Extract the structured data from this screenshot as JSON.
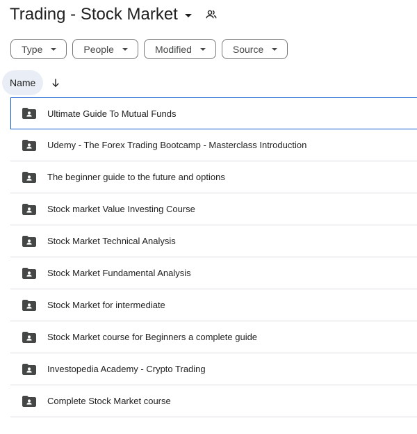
{
  "header": {
    "title": "Trading - Stock Market",
    "title_menu_icon": "caret-down-icon",
    "shared_icon": "people-icon"
  },
  "filters": [
    {
      "label": "Type"
    },
    {
      "label": "People"
    },
    {
      "label": "Modified"
    },
    {
      "label": "Source"
    }
  ],
  "column_header": {
    "name_label": "Name",
    "sort_icon": "arrow-down-icon"
  },
  "folders": [
    {
      "name": "Ultimate Guide To Mutual Funds",
      "selected": true
    },
    {
      "name": "Udemy - The Forex Trading Bootcamp - Masterclass Introduction",
      "selected": false
    },
    {
      "name": "The beginner guide to the future and options",
      "selected": false
    },
    {
      "name": "Stock market Value Investing Course",
      "selected": false
    },
    {
      "name": "Stock Market Technical Analysis",
      "selected": false
    },
    {
      "name": "Stock Market Fundamental Analysis",
      "selected": false
    },
    {
      "name": "Stock Market for intermediate",
      "selected": false
    },
    {
      "name": "Stock Market course for Beginners a complete guide",
      "selected": false
    },
    {
      "name": "Investopedia Academy - Crypto Trading",
      "selected": false
    },
    {
      "name": "Complete Stock Market course",
      "selected": false
    }
  ],
  "colors": {
    "selection_border": "#0b57d0",
    "header_pill": "#e9eef6",
    "folder_icon": "#444746"
  }
}
